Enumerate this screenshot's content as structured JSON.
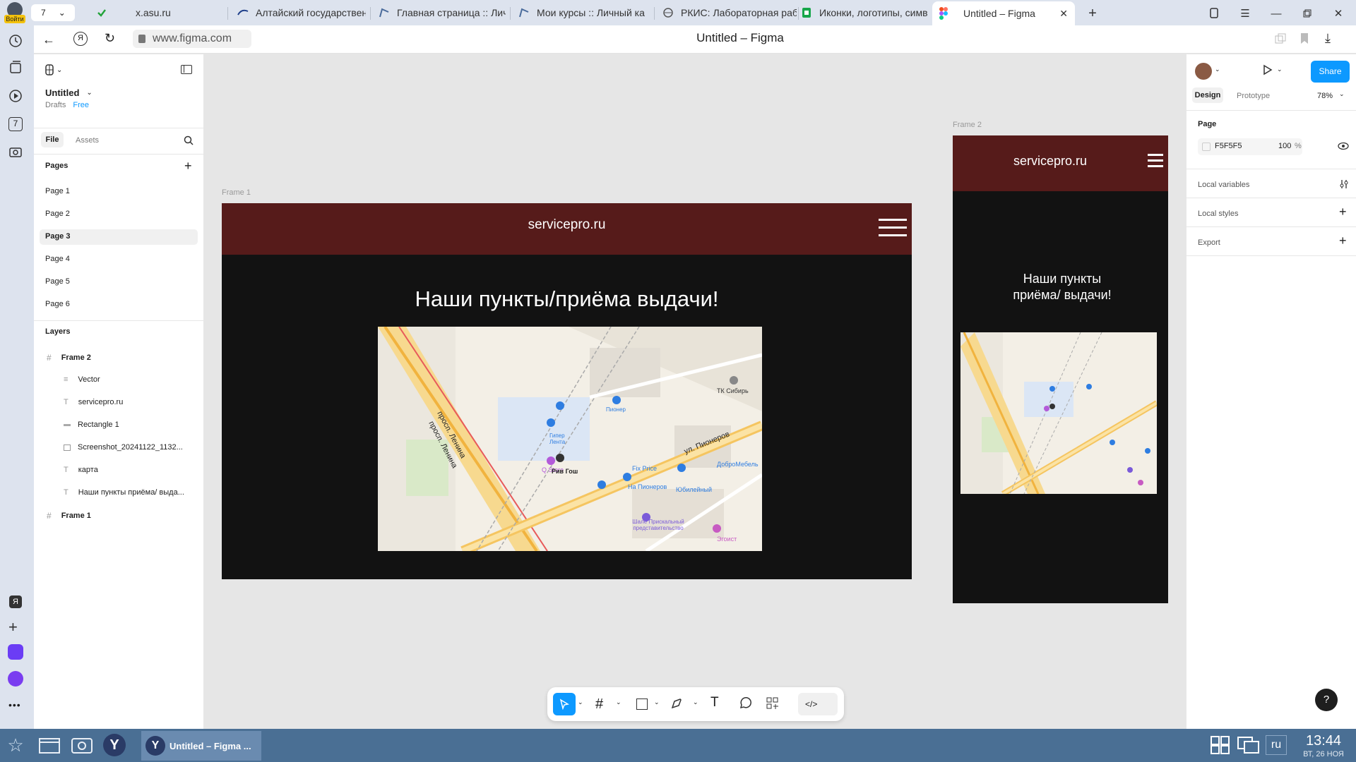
{
  "browser": {
    "tab_count": "7",
    "login_label": "Войти",
    "tabs": [
      {
        "label": "x.asu.ru"
      },
      {
        "label": "Алтайский государствен"
      },
      {
        "label": "Главная страница :: Личн"
      },
      {
        "label": "Мои курсы :: Личный ка"
      },
      {
        "label": "РКИС: Лабораторная раб"
      },
      {
        "label": "Иконки, логотипы, симв"
      },
      {
        "label": "Untitled – Figma"
      }
    ],
    "url": "www.figma.com",
    "page_title": "Untitled – Figma",
    "rail_badge": "7"
  },
  "figma": {
    "file_name": "Untitled",
    "drafts_label": "Drafts",
    "plan_label": "Free",
    "tabs": {
      "file": "File",
      "assets": "Assets"
    },
    "pages_header": "Pages",
    "pages": [
      "Page 1",
      "Page 2",
      "Page 3",
      "Page 4",
      "Page 5",
      "Page 6"
    ],
    "selected_page": "Page 3",
    "layers_header": "Layers",
    "layers": [
      {
        "name": "Frame 2",
        "type": "frame"
      },
      {
        "name": "Vector",
        "type": "vector"
      },
      {
        "name": "servicepro.ru",
        "type": "text"
      },
      {
        "name": "Rectangle 1",
        "type": "rect"
      },
      {
        "name": "Screenshot_20241122_1132...",
        "type": "image"
      },
      {
        "name": "карта",
        "type": "text"
      },
      {
        "name": "Наши пункты приёма/ выда...",
        "type": "text"
      },
      {
        "name": "Frame 1",
        "type": "frame"
      }
    ],
    "right_panel": {
      "share_label": "Share",
      "design_tab": "Design",
      "prototype_tab": "Prototype",
      "zoom": "78%",
      "page_section": "Page",
      "page_color": "F5F5F5",
      "page_opacity": "100",
      "percent": "%",
      "local_variables": "Local variables",
      "local_styles": "Local styles",
      "export": "Export"
    },
    "help_label": "?"
  },
  "canvas": {
    "frame1": {
      "label": "Frame 1",
      "site_title": "servicepro.ru",
      "heading": "Наши пункты/приёма выдачи!"
    },
    "frame2": {
      "label": "Frame 2",
      "site_title": "servicepro.ru",
      "heading_line1": "Наши пункты",
      "heading_line2": "приёма/ выдачи!"
    },
    "map_labels": {
      "street1": "просп. Ленина",
      "street2": "просп. Ленина",
      "street3": "ул. Пионеров",
      "poi_giper": "Гипер Лента",
      "poi_pioner": "Пионер",
      "poi_tk": "ТК Сибирь",
      "poi_qstore": "Q Store",
      "poi_rivgosh": "Рив Гош",
      "poi_fixprice": "Fix Price",
      "poi_dobro": "ДоброМебель",
      "poi_napioneров": "На Пионеров",
      "poi_yubil": "Юбилейный",
      "poi_shale": "Шале Прискальный представительство",
      "poi_egoist": "Эгоист"
    }
  },
  "taskbar": {
    "active_window": "Untitled – Figma ...",
    "language": "ru",
    "time": "13:44",
    "date": "ВТ, 26 НОЯ"
  }
}
